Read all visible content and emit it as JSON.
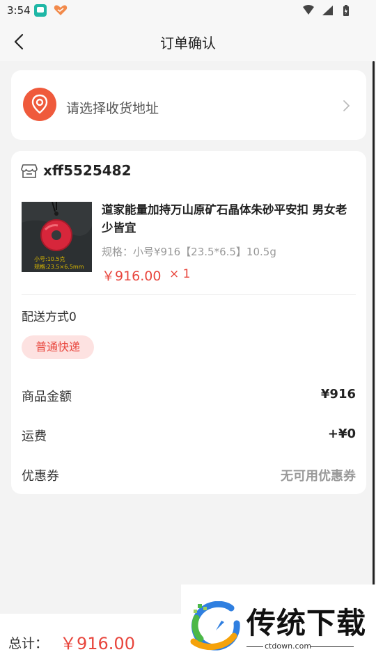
{
  "status_bar": {
    "time": "3:54"
  },
  "nav": {
    "title": "订单确认"
  },
  "address": {
    "placeholder_text": "请选择收货地址"
  },
  "order": {
    "shop_name": "xff5525482",
    "product": {
      "title": "道家能量加持万山原矿石晶体朱砂平安扣 男女老少皆宜",
      "spec": "规格：小号¥916【23.5*6.5】10.5g",
      "price": "￥916.00",
      "quantity": "× 1",
      "image_caption_line1": "小号:10.5克",
      "image_caption_line2": "规格:23.5×6.5mm"
    },
    "shipping": {
      "label": "配送方式0",
      "option": "普通快递"
    },
    "summary": [
      {
        "label": "商品金额",
        "value": "¥916"
      },
      {
        "label": "运费",
        "value": "+¥0"
      },
      {
        "label": "优惠券",
        "value": "无可用优惠券"
      }
    ]
  },
  "footer": {
    "total_label": "总计：",
    "total_value": "￥916.00"
  },
  "watermark": {
    "brand": "传统下载",
    "url": "ctdown.com"
  },
  "colors": {
    "accent": "#e8453c",
    "accent_light": "#fde2e1",
    "location_icon": "#ef5a3c"
  }
}
